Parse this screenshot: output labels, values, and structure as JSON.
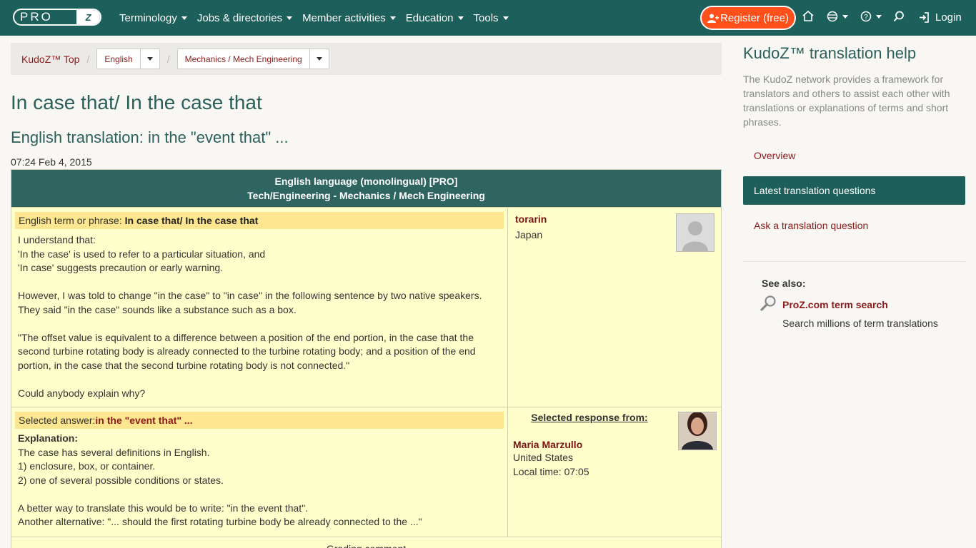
{
  "navbar": {
    "logo_text": "PRO",
    "logo_z": "Z",
    "menu": [
      {
        "label": "Terminology"
      },
      {
        "label": "Jobs & directories"
      },
      {
        "label": "Member activities"
      },
      {
        "label": "Education"
      },
      {
        "label": "Tools"
      }
    ],
    "register_label": "Register (free)",
    "login_label": "Login",
    "icons": [
      "home-icon",
      "globe-icon",
      "help-icon",
      "search-icon",
      "login-icon"
    ],
    "colors": {
      "bar": "#1d5f5a",
      "register": "#ff4f1a"
    }
  },
  "breadcrumb": {
    "top_label": "KudoZ™ Top",
    "language": "English",
    "field": "Mechanics / Mech Engineering"
  },
  "page": {
    "title": "In case that/ In the case that",
    "subtitle": "English translation: in the \"event that\" ...",
    "date": "07:24 Feb 4, 2015"
  },
  "question_table": {
    "header_line1": "English language (monolingual) [PRO]",
    "header_line2": "Tech/Engineering - Mechanics / Mech Engineering",
    "term_label": "English term or phrase: ",
    "term_value": "In case that/ In the case that",
    "question_body": "I understand that:\n'In the case' is used to refer to a particular situation, and\n'In case' suggests precaution or early warning.\n\nHowever, I was told to change \"in the case\" to \"in case\" in the following sentence by two native speakers.\nThey said \"in the case\" sounds like a substance such as a box.\n\n\"The offset value is equivalent to a difference between a position of the end portion, in the case that the\nsecond turbine rotating body is already connected to the turbine rotating body; and a position of the end\nportion, in the case that the second turbine rotating body is not connected.\"\n\nCould anybody explain why?",
    "asker": {
      "name": "torarin",
      "location": "Japan"
    },
    "selected_label": "Selected answer:",
    "selected_value": "in the \"event that\" ...",
    "explanation_label": "Explanation:",
    "explanation_body": "The case has several definitions in English.\n1) enclosure, box, or container.\n2) one of several possible conditions or states.\n\nA better way to translate this would be to write: \"in the event that\".\nAnother alternative: \"... should the first rotating turbine body be already connected to the ...\"",
    "responder": {
      "header": "Selected response from:",
      "name": "Maria Marzullo",
      "location": "United States",
      "local_time": "Local time: 07:05"
    },
    "grading_label": "Grading comment"
  },
  "sidebar": {
    "title": "KudoZ™ translation help",
    "description": "The KudoZ network provides a framework for translators and others to assist each other with translations or explanations of terms and short phrases.",
    "links": [
      {
        "label": "Overview",
        "active": false
      },
      {
        "label": "Latest translation questions",
        "active": true
      },
      {
        "label": "Ask a translation question",
        "active": false
      }
    ],
    "see_also_label": "See also:",
    "term_search_label": "ProZ.com term search",
    "term_search_desc": "Search millions of term translations"
  }
}
